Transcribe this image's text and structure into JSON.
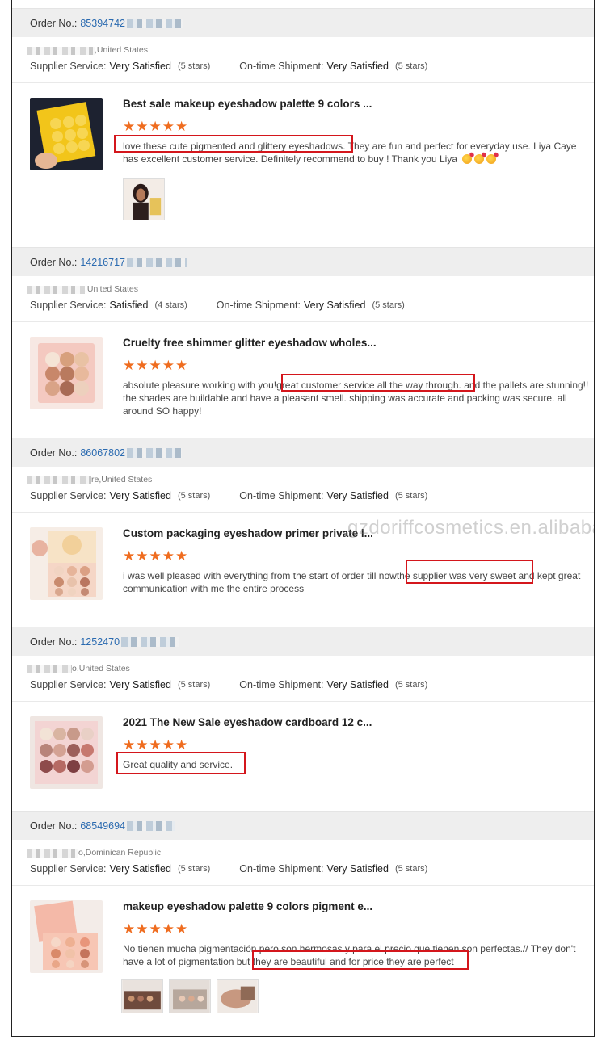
{
  "labels": {
    "order_no": "Order No.:",
    "supplier_service": "Supplier Service:",
    "ontime_shipment": "On-time Shipment:"
  },
  "watermark": "gzdoriffcosmetics.en.alibaba.com",
  "orders": [
    {
      "order_number": "85394742",
      "location": ",United States",
      "supplier_rating": "Very Satisfied",
      "supplier_stars": "(5 stars)",
      "shipment_rating": "Very Satisfied",
      "shipment_stars": "(5 stars)",
      "product_title": "Best sale makeup eyeshadow palette 9 colors ...",
      "stars": "★★★★★",
      "review_highlight": "love these cute pigmented and glittery eyeshadows.",
      "review_rest": " They are fun and perfect for everyday use. Liya Caye has excellent customer service. Definitely recommend to buy ! Thank you Liya"
    },
    {
      "order_number": "14216717",
      "location": ",United States",
      "supplier_rating": "Satisfied",
      "supplier_stars": "(4 stars)",
      "shipment_rating": "Very Satisfied",
      "shipment_stars": "(5 stars)",
      "product_title": "Cruelty free shimmer glitter eyeshadow wholes...",
      "stars": "★★★★★",
      "review_pre": "absolute pleasure working with you!",
      "review_highlight": "great customer service all the way through.",
      "review_rest": " and the pallets are stunning!! the shades are buildable and have a pleasant smell. shipping was accurate and packing was secure. all around SO happy!"
    },
    {
      "order_number": "86067802",
      "location": "re,United States",
      "supplier_rating": "Very Satisfied",
      "supplier_stars": "(5 stars)",
      "shipment_rating": "Very Satisfied",
      "shipment_stars": "(5 stars)",
      "product_title": "Custom packaging eyeshadow primer private l...",
      "stars": "★★★★★",
      "review_pre": "i was well pleased with everything from the start of order till now",
      "review_highlight": "the supplier was very sweet",
      "review_rest": " and kept great communication with me the entire process"
    },
    {
      "order_number": "1252470",
      "location": "o,United States",
      "supplier_rating": "Very Satisfied",
      "supplier_stars": "(5 stars)",
      "shipment_rating": "Very Satisfied",
      "shipment_stars": "(5 stars)",
      "product_title": "2021 The New Sale eyeshadow cardboard 12 c...",
      "stars": "★★★★★",
      "review_highlight": "Great quality and service."
    },
    {
      "order_number": "68549694",
      "location": "o,Dominican Republic",
      "supplier_rating": "Very Satisfied",
      "supplier_stars": "(5 stars)",
      "shipment_rating": "Very Satisfied",
      "shipment_stars": "(5 stars)",
      "product_title": "makeup eyeshadow palette 9 colors pigment e...",
      "stars": "★★★★★",
      "review_pre": "No tienen mucha pigmentación pero son hermosas y para el precio que tienen son perfectas.// They don't have a lot of pigmentation but",
      "review_highlight": " they are beautiful and for price they are perfect"
    }
  ]
}
